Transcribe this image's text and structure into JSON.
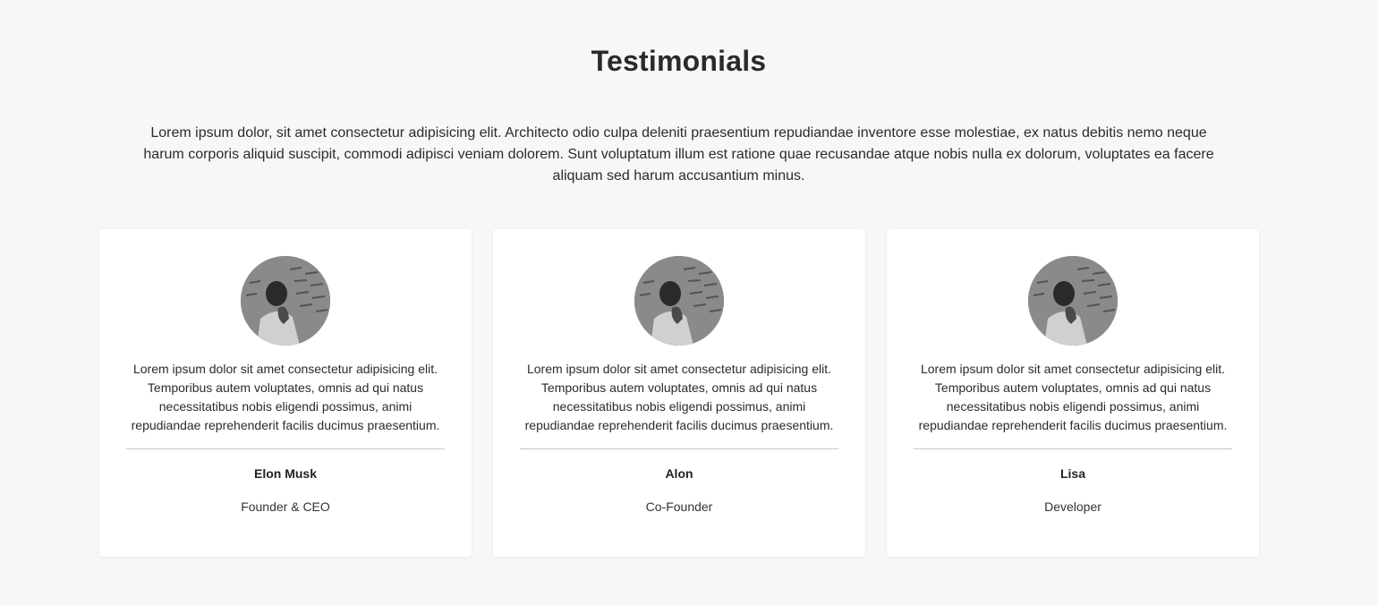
{
  "section": {
    "title": "Testimonials",
    "intro": "Lorem ipsum dolor, sit amet consectetur adipisicing elit. Architecto odio culpa deleniti praesentium repudiandae inventore esse molestiae, ex natus debitis nemo neque harum corporis aliquid suscipit, commodi adipisci veniam dolorem. Sunt voluptatum illum est ratione quae recusandae atque nobis nulla ex dolorum, voluptates ea facere aliquam sed harum accusantium minus."
  },
  "testimonials": [
    {
      "quote": "Lorem ipsum dolor sit amet consectetur adipisicing elit. Temporibus autem voluptates, omnis ad qui natus necessitatibus nobis eligendi possimus, animi repudiandae reprehenderit facilis ducimus praesentium.",
      "name": "Elon Musk",
      "role": "Founder & CEO"
    },
    {
      "quote": "Lorem ipsum dolor sit amet consectetur adipisicing elit. Temporibus autem voluptates, omnis ad qui natus necessitatibus nobis eligendi possimus, animi repudiandae reprehenderit facilis ducimus praesentium.",
      "name": "Alon",
      "role": "Co-Founder"
    },
    {
      "quote": "Lorem ipsum dolor sit amet consectetur adipisicing elit. Temporibus autem voluptates, omnis ad qui natus necessitatibus nobis eligendi possimus, animi repudiandae reprehenderit facilis ducimus praesentium.",
      "name": "Lisa",
      "role": "Developer"
    }
  ],
  "colors": {
    "background": "#f7f7f7",
    "card": "#ffffff",
    "text": "#222222",
    "divider": "#c8c8c8"
  }
}
